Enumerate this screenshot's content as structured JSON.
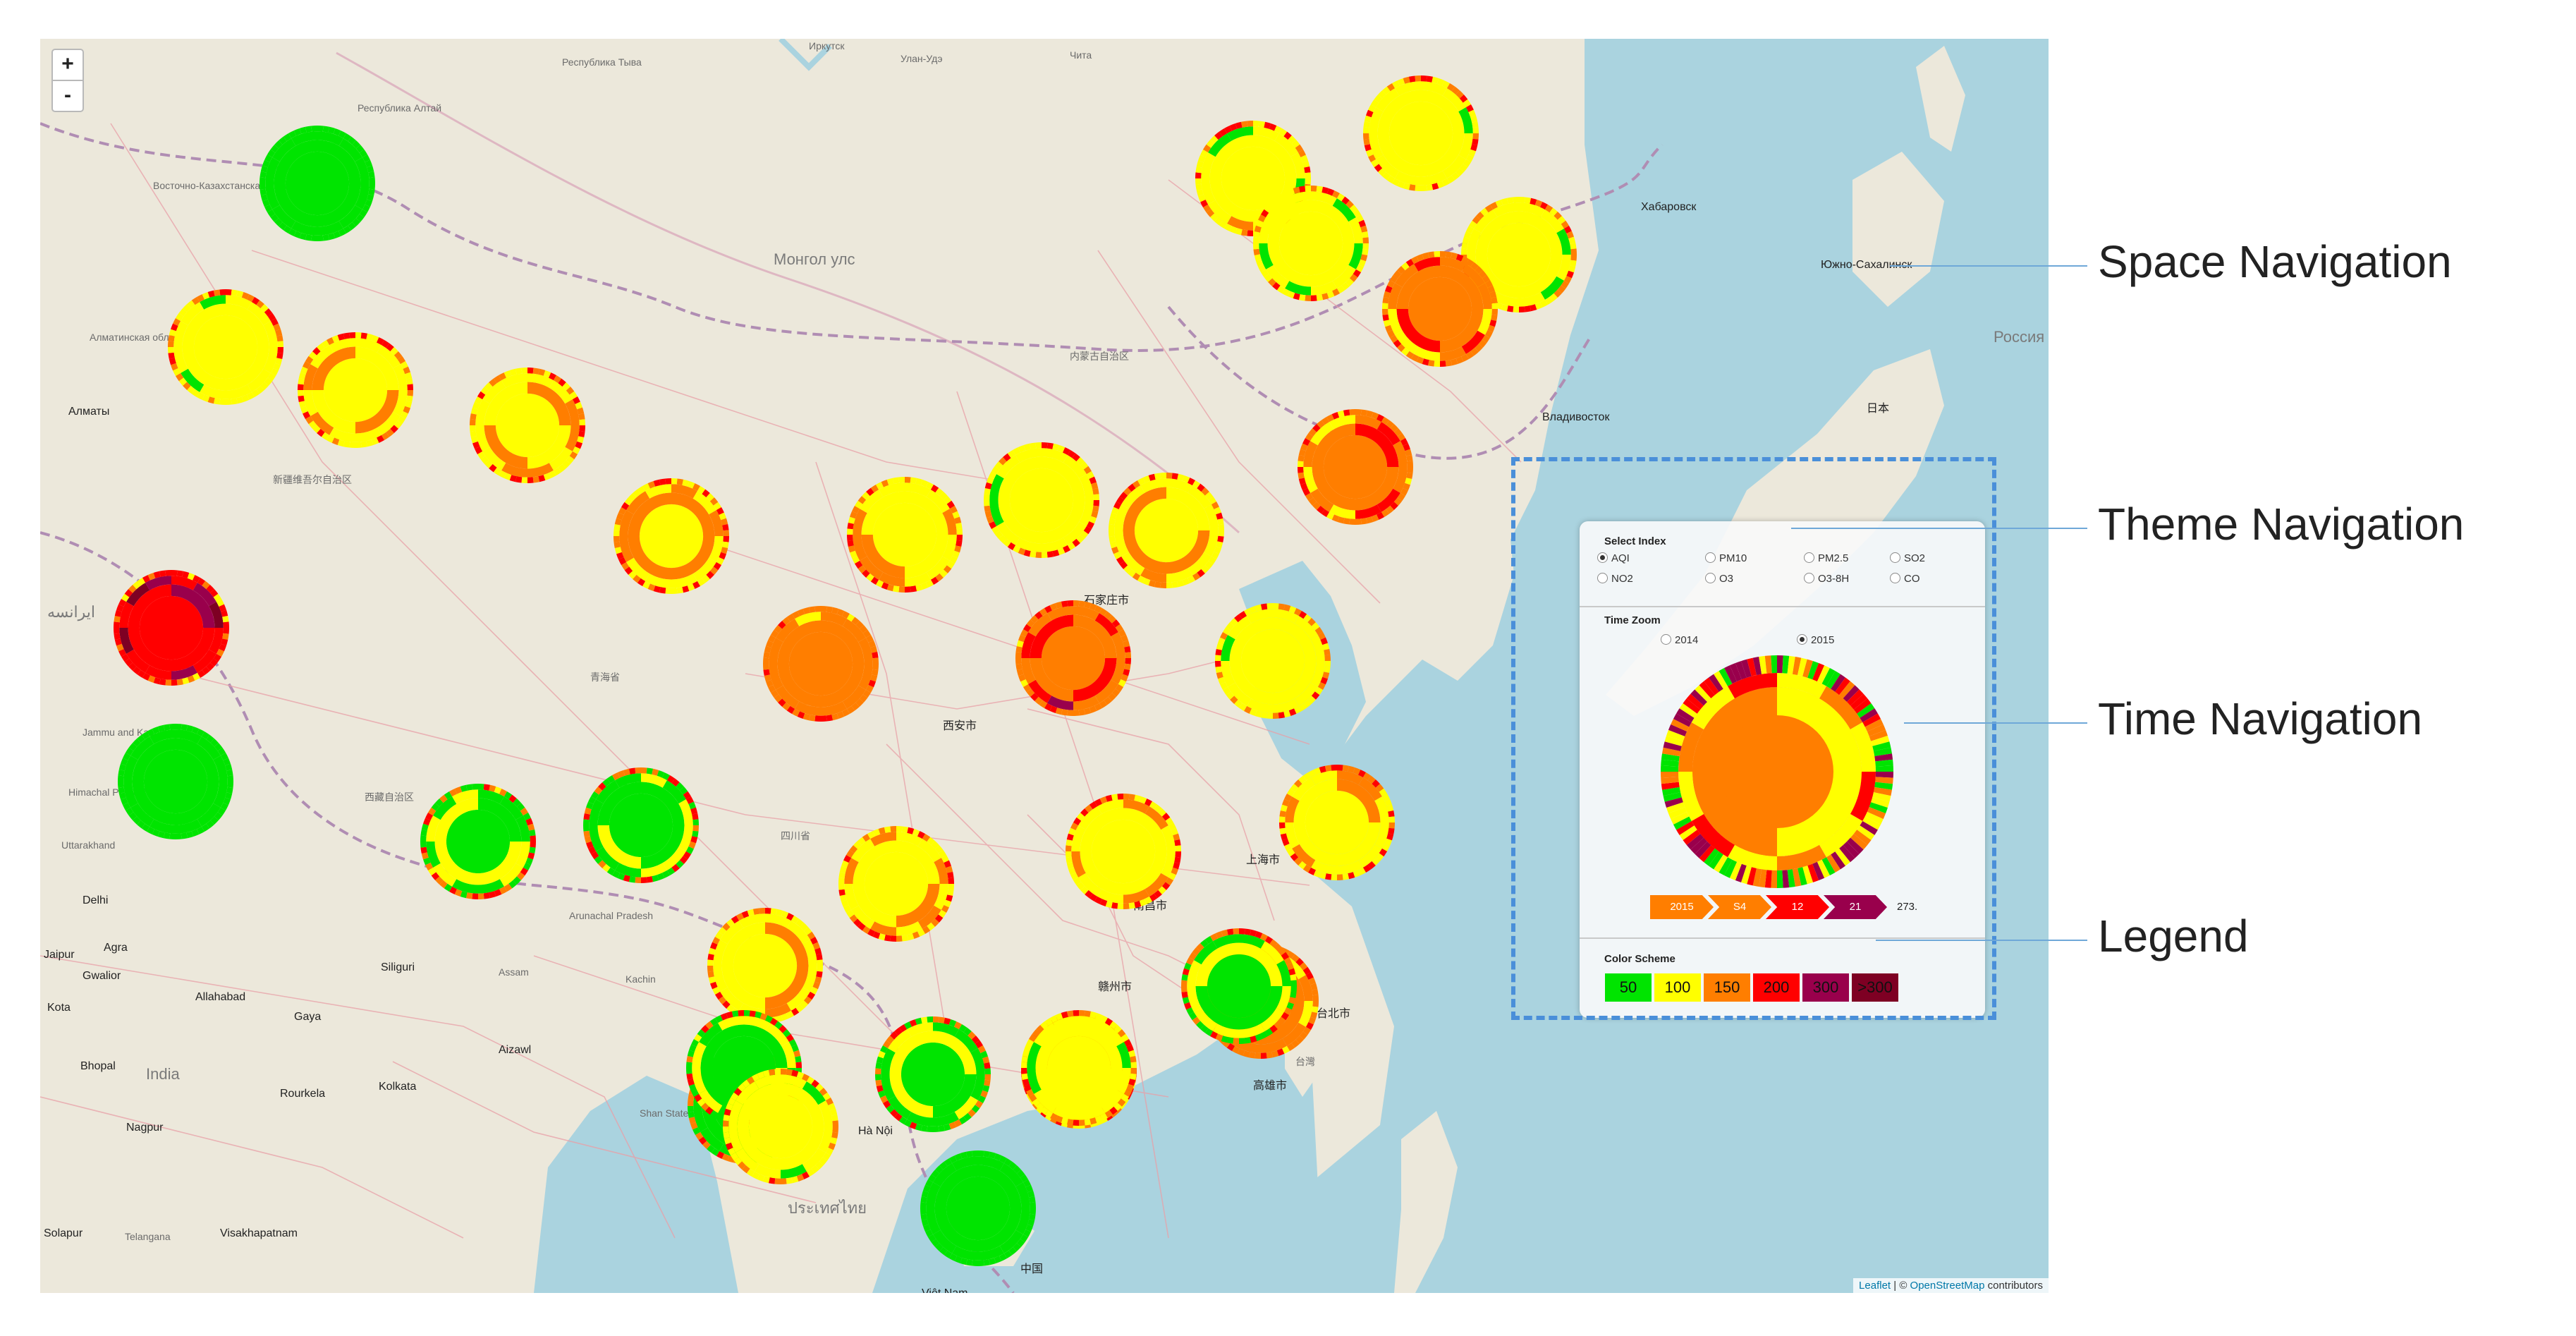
{
  "map": {
    "zoom_in": "+",
    "zoom_out": "-",
    "attribution": {
      "leaflet": "Leaflet",
      "separator": " | © ",
      "osm": "OpenStreetMap",
      "suffix": " contributors"
    },
    "places": [
      {
        "t": "Иркутск"
      },
      {
        "t": "Улан-Удэ"
      },
      {
        "t": "Чита"
      },
      {
        "t": "Республика Алтай"
      },
      {
        "t": "Республика Тыва"
      },
      {
        "t": "Восточно-Казахстанская область"
      },
      {
        "t": "Монгол улс"
      },
      {
        "t": "Хабаровск"
      },
      {
        "t": "Южно-Сахалинск"
      },
      {
        "t": "Россия Федерац"
      },
      {
        "t": "Владивосток"
      },
      {
        "t": "Алматы"
      },
      {
        "t": "新疆维吾尔自治区"
      },
      {
        "t": "Алматинская область"
      },
      {
        "t": "内蒙古自治区"
      },
      {
        "t": "石家庄市"
      },
      {
        "t": "西安市"
      },
      {
        "t": "青海省"
      },
      {
        "t": "西藏自治区"
      },
      {
        "t": "四川省"
      },
      {
        "t": "南昌市"
      },
      {
        "t": "上海市"
      },
      {
        "t": "赣州市"
      },
      {
        "t": "台北市"
      },
      {
        "t": "台灣"
      },
      {
        "t": "高雄市"
      },
      {
        "t": "Delhi"
      },
      {
        "t": "Agra"
      },
      {
        "t": "Jaipur"
      },
      {
        "t": "Gwalior"
      },
      {
        "t": "Kota"
      },
      {
        "t": "Allahabad"
      },
      {
        "t": "Gaya"
      },
      {
        "t": "Siliguri"
      },
      {
        "t": "Bhopal"
      },
      {
        "t": "India"
      },
      {
        "t": "Rourkela"
      },
      {
        "t": "Kolkata"
      },
      {
        "t": "Aizawl"
      },
      {
        "t": "Nagpur"
      },
      {
        "t": "Solapur"
      },
      {
        "t": "Telangana"
      },
      {
        "t": "Visakhapatnam"
      },
      {
        "t": "Hà Nội"
      },
      {
        "t": "ประเทศไทย"
      },
      {
        "t": "中国"
      },
      {
        "t": "日本"
      },
      {
        "t": "ايرانسه"
      },
      {
        "t": "Jammu and Kashmir"
      },
      {
        "t": "Uttarakhand"
      },
      {
        "t": "Himachal Pradesh"
      },
      {
        "t": "Arunachal Pradesh"
      },
      {
        "t": "Assam"
      },
      {
        "t": "Kachin"
      },
      {
        "t": "Shan State"
      },
      {
        "t": "Việt Nam"
      }
    ]
  },
  "panel": {
    "select_index": {
      "title": "Select Index",
      "options": [
        {
          "label": "AQI",
          "selected": true
        },
        {
          "label": "PM10",
          "selected": false
        },
        {
          "label": "PM2.5",
          "selected": false
        },
        {
          "label": "SO2",
          "selected": false
        },
        {
          "label": "NO2",
          "selected": false
        },
        {
          "label": "O3",
          "selected": false
        },
        {
          "label": "O3-8H",
          "selected": false
        },
        {
          "label": "CO",
          "selected": false
        }
      ]
    },
    "time_zoom": {
      "title": "Time Zoom",
      "options": [
        {
          "label": "2014",
          "selected": false
        },
        {
          "label": "2015",
          "selected": true
        }
      ],
      "breadcrumb": [
        "2015",
        "S4",
        "12",
        "21"
      ],
      "breadcrumb_tail": "273."
    },
    "color_scheme": {
      "title": "Color Scheme",
      "items": [
        {
          "label": "50",
          "color": "#00e400"
        },
        {
          "label": "100",
          "color": "#ffff00"
        },
        {
          "label": "150",
          "color": "#ff7e00"
        },
        {
          "label": "200",
          "color": "#ff0000"
        },
        {
          "label": "300",
          "color": "#99004c"
        },
        {
          "label": ">300",
          "color": "#7e0023"
        }
      ]
    }
  },
  "callouts": [
    {
      "label": "Space Navigation"
    },
    {
      "label": "Theme Navigation"
    },
    {
      "label": "Time Navigation"
    },
    {
      "label": "Legend"
    }
  ],
  "colors": {
    "good": "#00e400",
    "moderate": "#ffff00",
    "sensitive": "#ff7e00",
    "unhealthy": "#ff0000",
    "very_unhealthy": "#99004c",
    "hazardous": "#7e0023",
    "callout_line": "#6fa8d8",
    "dash_box": "#4a8fd9"
  },
  "stations": [
    {
      "profile": "ygo"
    },
    {
      "profile": "yg"
    },
    {
      "profile": "yg"
    },
    {
      "profile": "yg"
    },
    {
      "profile": "orr"
    },
    {
      "profile": "green"
    },
    {
      "profile": "yg"
    },
    {
      "profile": "yo"
    },
    {
      "profile": "yo"
    },
    {
      "profile": "orr"
    },
    {
      "profile": "yo"
    },
    {
      "profile": "yg"
    },
    {
      "profile": "yo"
    },
    {
      "profile": "yo"
    },
    {
      "profile": "or"
    },
    {
      "profile": "oym"
    },
    {
      "profile": "yg"
    },
    {
      "profile": "yo"
    },
    {
      "profile": "yo"
    },
    {
      "profile": "yo"
    },
    {
      "profile": "redp"
    },
    {
      "profile": "green"
    },
    {
      "profile": "gy"
    },
    {
      "profile": "gy"
    },
    {
      "profile": "yo"
    },
    {
      "profile": "or"
    },
    {
      "profile": "yo"
    },
    {
      "profile": "gy"
    },
    {
      "profile": "gy"
    },
    {
      "profile": "gy"
    },
    {
      "profile": "yg"
    },
    {
      "profile": "yg"
    },
    {
      "profile": "gy"
    },
    {
      "profile": "green"
    }
  ]
}
